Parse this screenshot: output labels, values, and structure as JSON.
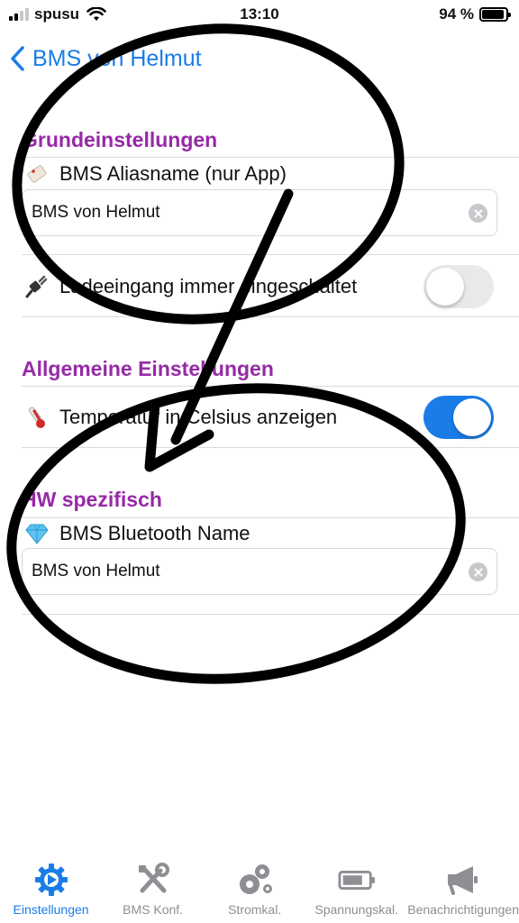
{
  "status_bar": {
    "carrier": "spusu",
    "time": "13:10",
    "battery_percent": "94 %",
    "battery_level": 0.94
  },
  "nav": {
    "back_title": "BMS von Helmut"
  },
  "sections": [
    {
      "title": "Grundeinstellungen",
      "alias_label": "BMS Aliasname (nur App)",
      "alias_value": "BMS von Helmut",
      "alias_icon": "tag-icon",
      "charge_label": "Ladeeingang immer eingeschaltet",
      "charge_icon": "plug-icon",
      "charge_on": false
    },
    {
      "title": "Allgemeine Einstellungen",
      "temp_label": "Temperatur in Celsius anzeigen",
      "temp_icon": "thermometer-icon",
      "temp_on": true
    },
    {
      "title": "HW spezifisch",
      "bt_label": "BMS Bluetooth Name",
      "bt_value": "BMS von Helmut",
      "bt_icon": "diamond-icon"
    }
  ],
  "tabs": [
    {
      "label": "Einstellungen",
      "icon": "gear-icon",
      "active": true
    },
    {
      "label": "BMS Konf.",
      "icon": "wrench-screwdriver-icon",
      "active": false
    },
    {
      "label": "Stromkal.",
      "icon": "gears-icon",
      "active": false
    },
    {
      "label": "Spannungskal.",
      "icon": "battery-icon",
      "active": false
    },
    {
      "label": "Benachrichtigungen",
      "icon": "megaphone-icon",
      "active": false
    }
  ],
  "colors": {
    "accent": "#1a7ce6",
    "section_title": "#962aa6",
    "annotation": "#000000"
  }
}
